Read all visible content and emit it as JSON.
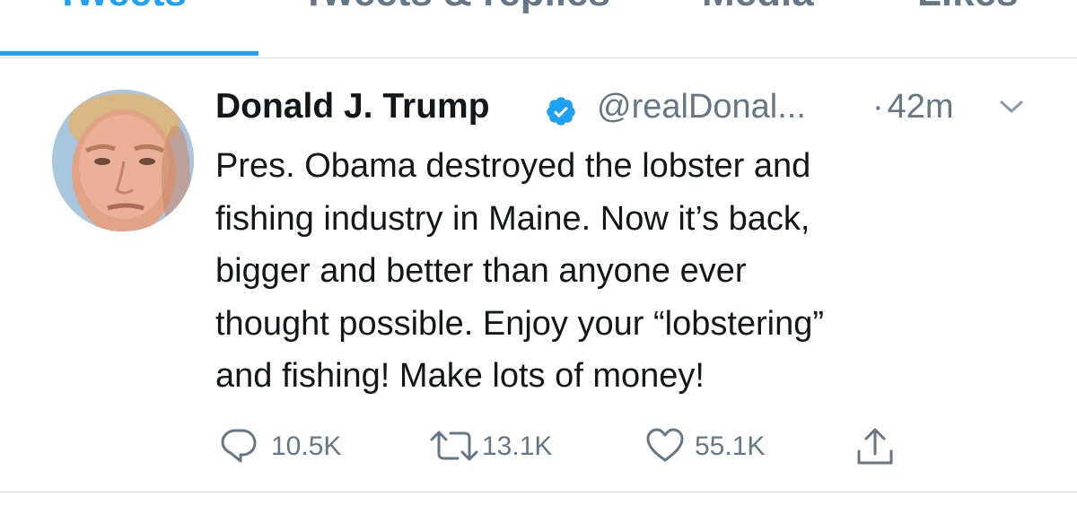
{
  "tabs": [
    {
      "label": "Tweets",
      "active": true
    },
    {
      "label": "Tweets & replies",
      "active": false
    },
    {
      "label": "Media",
      "active": false
    },
    {
      "label": "Likes",
      "active": false
    }
  ],
  "tweet": {
    "display_name": "Donald J. Trump",
    "verified": true,
    "handle": "@realDonal...",
    "dot": "·",
    "time": "42m",
    "avatar_icon": "profile-photo",
    "text": "Pres. Obama destroyed the lobster and\nfishing industry in Maine. Now it’s back,\nbigger and better than anyone ever\nthought possible. Enjoy your “lobstering”\nand fishing! Make lots of money!",
    "actions": {
      "reply_count": "10.5K",
      "retweet_count": "13.1K",
      "like_count": "55.1K"
    }
  },
  "icons": {
    "reply": "reply-icon",
    "retweet": "retweet-icon",
    "like": "heart-icon",
    "share": "share-icon",
    "verified": "verified-badge-icon",
    "menu": "chevron-down-icon"
  },
  "colors": {
    "accent": "#1da1f2",
    "text": "#14171a",
    "secondary": "#657786",
    "divider": "#d8dde1"
  }
}
